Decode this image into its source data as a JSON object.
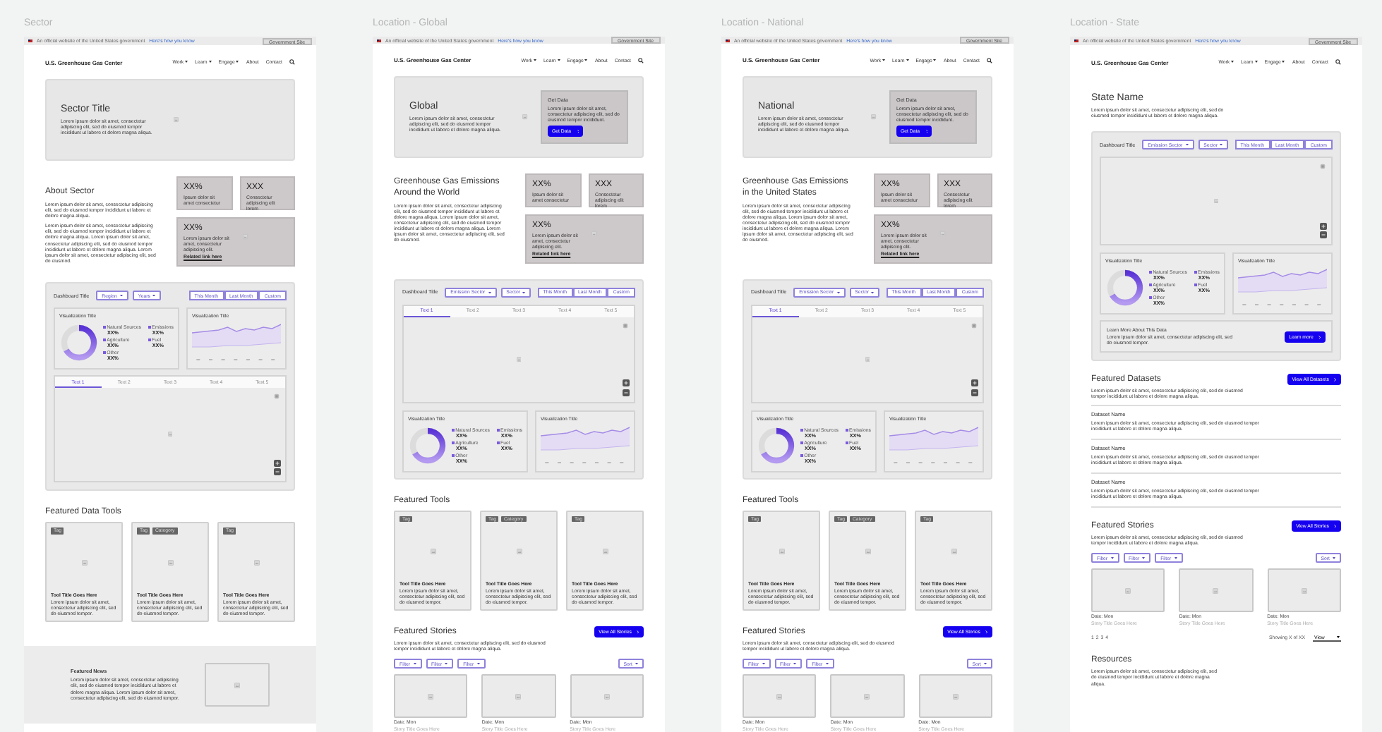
{
  "frames": [
    {
      "label": "Sector",
      "banner": {
        "text": "An official website of the United States government",
        "link": "Here's how you know",
        "button": "Government Site"
      },
      "header": {
        "title": "U.S. Greenhouse Gas Center",
        "nav": [
          {
            "label": "Work",
            "menu": true
          },
          {
            "label": "Learn",
            "menu": true
          },
          {
            "label": "Engage",
            "menu": true
          },
          {
            "label": "About",
            "menu": false
          },
          {
            "label": "Contact",
            "menu": false
          }
        ]
      },
      "sections": [
        {
          "kind": "hero",
          "title": "Sector Title",
          "text": "Lorem ipsum dolor sit amet, consectetur adipiscing elit, sed do eiusmod tempor incididunt ut labore et dolore magna aliqua."
        },
        {
          "kind": "about",
          "title": "About Sector",
          "paragraphs": [
            "Lorem ipsum dolor sit amet, consectetur adipiscing elit, sed do eiusmod tempor incididunt ut labore et dolore magna aliqua.",
            "Lorem ipsum dolor sit amet, consectetur adipiscing elit, sed do eiusmod tempor incididunt ut labore et dolore magna aliqua. Lorem ipsum dolor sit amet, consectetur adipiscing elit, sed do eiusmod tempor incididunt ut labore et dolore magna aliqua. Lorem ipsum dolor sit amet, consectetur adipiscing elit, sed do eiusmod."
          ],
          "stats": [
            {
              "value": "XX%",
              "text": "Ipsum dolor sit amet consectetur"
            },
            {
              "value": "XXX",
              "text": "Consectetur adipiscing elit lorem"
            },
            {
              "value": "XX%",
              "text": "Lorem ipsum dolor sit amet, consectetur adipiscing elit.",
              "link": "Related link here"
            }
          ]
        },
        {
          "kind": "dashboard",
          "title": "Dashboard Title",
          "dropdowns": [
            "Region",
            "Years"
          ],
          "buttons": [
            "This Month",
            "Last Month",
            "Custom"
          ],
          "parts": [
            {
              "kind": "viz",
              "donut_title": "Visualization Title",
              "legend": [
                {
                  "label": "Natural Sources",
                  "value": "XX%"
                },
                {
                  "label": "Emissions",
                  "value": "XX%"
                },
                {
                  "label": "Agriculture",
                  "value": "XX%"
                },
                {
                  "label": "Fuel",
                  "value": "XX%"
                },
                {
                  "label": "Other",
                  "value": "XX%"
                }
              ],
              "line_title": "Visualization Title"
            },
            {
              "kind": "map",
              "tabs": [
                {
                  "label": "Text 1",
                  "selected": true
                },
                {
                  "label": "Text 2",
                  "selected": false
                },
                {
                  "label": "Text 3",
                  "selected": false
                },
                {
                  "label": "Text 4",
                  "selected": false
                },
                {
                  "label": "Text 5",
                  "selected": false
                }
              ]
            }
          ]
        },
        {
          "kind": "tools",
          "title": "Featured Data Tools",
          "cards": [
            {
              "tags": [
                "Tag"
              ],
              "title": "Tool Title Goes Here",
              "text": "Lorem ipsum dolor sit amet, consectetur adipiscing elit, sed do eiusmod tempor."
            },
            {
              "tags": [
                "Tag",
                "Category"
              ],
              "title": "Tool Title Goes Here",
              "text": "Lorem ipsum dolor sit amet, consectetur adipiscing elit, sed do eiusmod tempor."
            },
            {
              "tags": [
                "Tag"
              ],
              "title": "Tool Title Goes Here",
              "text": "Lorem ipsum dolor sit amet, consectetur adipiscing elit, sed do eiusmod tempor."
            }
          ]
        },
        {
          "kind": "news",
          "title": "Featured News",
          "text": "Lorem ipsum dolor sit amet, consectetur adipiscing elit, sed do eiusmod tempor incididunt ut labore et dolore magna aliqua. Lorem ipsum dolor sit amet, consectetur adipiscing elit, sed do eiusmod tempor."
        }
      ]
    },
    {
      "label": "Location - Global",
      "banner": {
        "text": "An official website of the United States government",
        "link": "Here's how you know",
        "button": "Government Site"
      },
      "header": {
        "title": "U.S. Greenhouse Gas Center",
        "nav": [
          {
            "label": "Work",
            "menu": true
          },
          {
            "label": "Learn",
            "menu": true
          },
          {
            "label": "Engage",
            "menu": true
          },
          {
            "label": "About",
            "menu": false
          },
          {
            "label": "Contact",
            "menu": false
          }
        ]
      },
      "sections": [
        {
          "kind": "hero",
          "title": "Global",
          "text": "Lorem ipsum dolor sit amet, consectetur adipiscing elit, sed do eiusmod tempor incididunt ut labore et dolore magna aliqua.",
          "get_data": {
            "title": "Get Data",
            "text": "Lorem ipsum dolor sit amet, consectetur adipiscing elit, sed do eiusmod tempor incididunt.",
            "button": "Get Data"
          }
        },
        {
          "kind": "about",
          "title": "Greenhouse Gas Emissions Around the World",
          "paragraphs": [
            "Lorem ipsum dolor sit amet, consectetur adipiscing elit, sed do eiusmod tempor incididunt ut labore et dolore magna aliqua. Lorem ipsum dolor sit amet, consectetur adipiscing elit, sed do eiusmod tempor incididunt ut labore et dolore magna aliqua. Lorem ipsum dolor sit amet, consectetur adipiscing elit, sed do eiusmod."
          ],
          "stats": [
            {
              "value": "XX%",
              "text": "Ipsum dolor sit amet consectetur"
            },
            {
              "value": "XXX",
              "text": "Consectetur adipiscing elit lorem"
            },
            {
              "value": "XX%",
              "text": "Lorem ipsum dolor sit amet, consectetur adipiscing elit.",
              "link": "Related link here"
            }
          ]
        },
        {
          "kind": "dashboard",
          "title": "Dashboard Title",
          "dropdowns": [
            "Emission Sector",
            "Sector"
          ],
          "buttons": [
            "This Month",
            "Last Month",
            "Custom"
          ],
          "parts": [
            {
              "kind": "map",
              "tabs": [
                {
                  "label": "Text 1",
                  "selected": true
                },
                {
                  "label": "Text 2",
                  "selected": false
                },
                {
                  "label": "Text 3",
                  "selected": false
                },
                {
                  "label": "Text 4",
                  "selected": false
                },
                {
                  "label": "Text 5",
                  "selected": false
                }
              ]
            },
            {
              "kind": "viz",
              "donut_title": "Visualization Title",
              "legend": [
                {
                  "label": "Natural Sources",
                  "value": "XX%"
                },
                {
                  "label": "Emissions",
                  "value": "XX%"
                },
                {
                  "label": "Agriculture",
                  "value": "XX%"
                },
                {
                  "label": "Fuel",
                  "value": "XX%"
                },
                {
                  "label": "Other",
                  "value": "XX%"
                }
              ],
              "line_title": "Visualization Title"
            }
          ]
        },
        {
          "kind": "tools",
          "title": "Featured Tools",
          "cards": [
            {
              "tags": [
                "Tag"
              ],
              "title": "Tool Title Goes Here",
              "text": "Lorem ipsum dolor sit amet, consectetur adipiscing elit, sed do eiusmod tempor."
            },
            {
              "tags": [
                "Tag",
                "Category"
              ],
              "title": "Tool Title Goes Here",
              "text": "Lorem ipsum dolor sit amet, consectetur adipiscing elit, sed do eiusmod tempor."
            },
            {
              "tags": [
                "Tag"
              ],
              "title": "Tool Title Goes Here",
              "text": "Lorem ipsum dolor sit amet, consectetur adipiscing elit, sed do eiusmod tempor."
            }
          ]
        },
        {
          "kind": "stories",
          "title": "Featured Stories",
          "text": "Lorem ipsum dolor sit amet, consectetur adipiscing elit, sed do eiusmod tempor incididunt ut labore et dolore magna aliqua.",
          "button": "View All Stories",
          "filters": [
            "Filter",
            "Filter",
            "Filter"
          ],
          "sort": "Sort",
          "cards": [
            {
              "date": "Date: Mon",
              "title": "Story Title Goes Here"
            },
            {
              "date": "Date: Mon",
              "title": "Story Title Goes Here"
            },
            {
              "date": "Date: Mon",
              "title": "Story Title Goes Here"
            }
          ]
        }
      ]
    },
    {
      "label": "Location - National",
      "banner": {
        "text": "An official website of the United States government",
        "link": "Here's how you know",
        "button": "Government Site"
      },
      "header": {
        "title": "U.S. Greenhouse Gas Center",
        "nav": [
          {
            "label": "Work",
            "menu": true
          },
          {
            "label": "Learn",
            "menu": true
          },
          {
            "label": "Engage",
            "menu": true
          },
          {
            "label": "About",
            "menu": false
          },
          {
            "label": "Contact",
            "menu": false
          }
        ]
      },
      "sections": [
        {
          "kind": "hero",
          "title": "National",
          "text": "Lorem ipsum dolor sit amet, consectetur adipiscing elit, sed do eiusmod tempor incididunt ut labore et dolore magna aliqua.",
          "get_data": {
            "title": "Get Data",
            "text": "Lorem ipsum dolor sit amet, consectetur adipiscing elit, sed do eiusmod tempor incididunt.",
            "button": "Get Data"
          }
        },
        {
          "kind": "about",
          "title": "Greenhouse Gas Emissions in the United States",
          "paragraphs": [
            "Lorem ipsum dolor sit amet, consectetur adipiscing elit, sed do eiusmod tempor incididunt ut labore et dolore magna aliqua. Lorem ipsum dolor sit amet, consectetur adipiscing elit, sed do eiusmod tempor incididunt ut labore et dolore magna aliqua. Lorem ipsum dolor sit amet, consectetur adipiscing elit, sed do eiusmod."
          ],
          "stats": [
            {
              "value": "XX%",
              "text": "Ipsum dolor sit amet consectetur"
            },
            {
              "value": "XXX",
              "text": "Consectetur adipiscing elit lorem"
            },
            {
              "value": "XX%",
              "text": "Lorem ipsum dolor sit amet, consectetur adipiscing elit.",
              "link": "Related link here"
            }
          ]
        },
        {
          "kind": "dashboard",
          "title": "Dashboard Title",
          "dropdowns": [
            "Emission Sector",
            "Sector"
          ],
          "buttons": [
            "This Month",
            "Last Month",
            "Custom"
          ],
          "parts": [
            {
              "kind": "map",
              "tabs": [
                {
                  "label": "Text 1",
                  "selected": true
                },
                {
                  "label": "Text 2",
                  "selected": false
                },
                {
                  "label": "Text 3",
                  "selected": false
                },
                {
                  "label": "Text 4",
                  "selected": false
                },
                {
                  "label": "Text 5",
                  "selected": false
                }
              ]
            },
            {
              "kind": "viz",
              "donut_title": "Visualization Title",
              "legend": [
                {
                  "label": "Natural Sources",
                  "value": "XX%"
                },
                {
                  "label": "Emissions",
                  "value": "XX%"
                },
                {
                  "label": "Agriculture",
                  "value": "XX%"
                },
                {
                  "label": "Fuel",
                  "value": "XX%"
                },
                {
                  "label": "Other",
                  "value": "XX%"
                }
              ],
              "line_title": "Visualization Title"
            }
          ]
        },
        {
          "kind": "tools",
          "title": "Featured Tools",
          "cards": [
            {
              "tags": [
                "Tag"
              ],
              "title": "Tool Title Goes Here",
              "text": "Lorem ipsum dolor sit amet, consectetur adipiscing elit, sed do eiusmod tempor."
            },
            {
              "tags": [
                "Tag",
                "Category"
              ],
              "title": "Tool Title Goes Here",
              "text": "Lorem ipsum dolor sit amet, consectetur adipiscing elit, sed do eiusmod tempor."
            },
            {
              "tags": [
                "Tag"
              ],
              "title": "Tool Title Goes Here",
              "text": "Lorem ipsum dolor sit amet, consectetur adipiscing elit, sed do eiusmod tempor."
            }
          ]
        },
        {
          "kind": "stories",
          "title": "Featured Stories",
          "text": "Lorem ipsum dolor sit amet, consectetur adipiscing elit, sed do eiusmod tempor incididunt ut labore et dolore magna aliqua.",
          "button": "View All Stories",
          "filters": [
            "Filter",
            "Filter",
            "Filter"
          ],
          "sort": "Sort",
          "cards": [
            {
              "date": "Date: Mon",
              "title": "Story Title Goes Here"
            },
            {
              "date": "Date: Mon",
              "title": "Story Title Goes Here"
            },
            {
              "date": "Date: Mon",
              "title": "Story Title Goes Here"
            }
          ]
        }
      ]
    },
    {
      "label": "Location - State",
      "banner": {
        "text": "An official website of the United States government",
        "link": "Here's how you know",
        "button": "Government Site"
      },
      "header": {
        "title": "U.S. Greenhouse Gas Center",
        "nav": [
          {
            "label": "Work",
            "menu": true
          },
          {
            "label": "Learn",
            "menu": true
          },
          {
            "label": "Engage",
            "menu": true
          },
          {
            "label": "About",
            "menu": false
          },
          {
            "label": "Contact",
            "menu": false
          }
        ]
      },
      "sections": [
        {
          "kind": "intro",
          "title": "State Name",
          "text": "Lorem ipsum dolor sit amet, consectetur adipiscing elit, sed do eiusmod tempor incididunt ut labore et dolore magna aliqua."
        },
        {
          "kind": "dashboard",
          "title": "Dashboard Title",
          "dropdowns": [
            "Emission Sector",
            "Sector"
          ],
          "buttons": [
            "This Month",
            "Last Month",
            "Custom"
          ],
          "parts": [
            {
              "kind": "map"
            },
            {
              "kind": "viz",
              "donut_title": "Visualization Title",
              "legend": [
                {
                  "label": "Natural Sources",
                  "value": "XX%"
                },
                {
                  "label": "Emissions",
                  "value": "XX%"
                },
                {
                  "label": "Agriculture",
                  "value": "XX%"
                },
                {
                  "label": "Fuel",
                  "value": "XX%"
                },
                {
                  "label": "Other",
                  "value": "XX%"
                }
              ],
              "line_title": "Visualization Title"
            },
            {
              "kind": "learn_more",
              "title": "Learn More About This Data",
              "text": "Lorem ipsum dolor sit amet, consectetur adipiscing elit, sed do eiusmod tempor.",
              "button": "Learn more"
            }
          ]
        },
        {
          "kind": "datasets",
          "title": "Featured Datasets",
          "text": "Lorem ipsum dolor sit amet, consectetur adipiscing elit, sed do eiusmod tempor incididunt ut labore et dolore magna aliqua.",
          "button": "View All Datasets",
          "items": [
            {
              "name": "Dataset Name",
              "text": "Lorem ipsum dolor sit amet, consectetur adipiscing elit, sed do eiusmod tempor incididunt ut labore et dolore magna aliqua."
            },
            {
              "name": "Dataset Name",
              "text": "Lorem ipsum dolor sit amet, consectetur adipiscing elit, sed do eiusmod tempor incididunt ut labore et dolore magna aliqua."
            },
            {
              "name": "Dataset Name",
              "text": "Lorem ipsum dolor sit amet, consectetur adipiscing elit, sed do eiusmod tempor incididunt ut labore et dolore magna aliqua."
            }
          ]
        },
        {
          "kind": "stories",
          "title": "Featured Stories",
          "text": "Lorem ipsum dolor sit amet, consectetur adipiscing elit, sed do eiusmod tempor incididunt ut labore et dolore magna aliqua.",
          "button": "View All Stories",
          "filters": [
            "Filter",
            "Filter",
            "Filter"
          ],
          "sort": "Sort",
          "cards": [
            {
              "date": "Date: Mon",
              "title": "Story Title Goes Here"
            },
            {
              "date": "Date: Mon",
              "title": "Story Title Goes Here"
            },
            {
              "date": "Date: Mon",
              "title": "Story Title Goes Here"
            }
          ],
          "pages": [
            "1",
            "2",
            "3",
            "4"
          ],
          "showing": "Showing X of XX",
          "view": "View"
        },
        {
          "kind": "resources",
          "title": "Resources",
          "text": "Lorem ipsum dolor sit amet, consectetur adipiscing elit, sed do eiusmod tempor incididunt ut labore et dolore magna aliqua."
        }
      ]
    }
  ]
}
